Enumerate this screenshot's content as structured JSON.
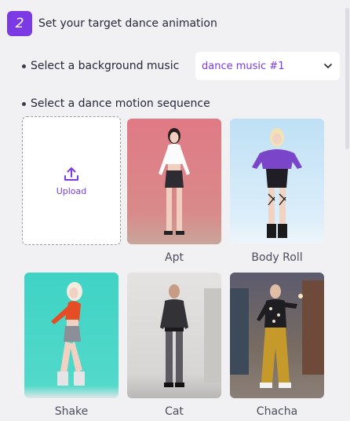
{
  "header": {
    "step_number": "2",
    "title": "Set your target dance animation"
  },
  "music": {
    "label": "Select a background music",
    "selected": "dance music #1"
  },
  "motion": {
    "label": "Select a dance motion sequence",
    "upload_label": "Upload",
    "items": [
      {
        "name": "Apt"
      },
      {
        "name": "Body Roll"
      },
      {
        "name": "Shake"
      },
      {
        "name": "Cat"
      },
      {
        "name": "Chacha"
      }
    ]
  },
  "colors": {
    "accent": "#7b3ae4",
    "background": "#f1f1f4"
  }
}
